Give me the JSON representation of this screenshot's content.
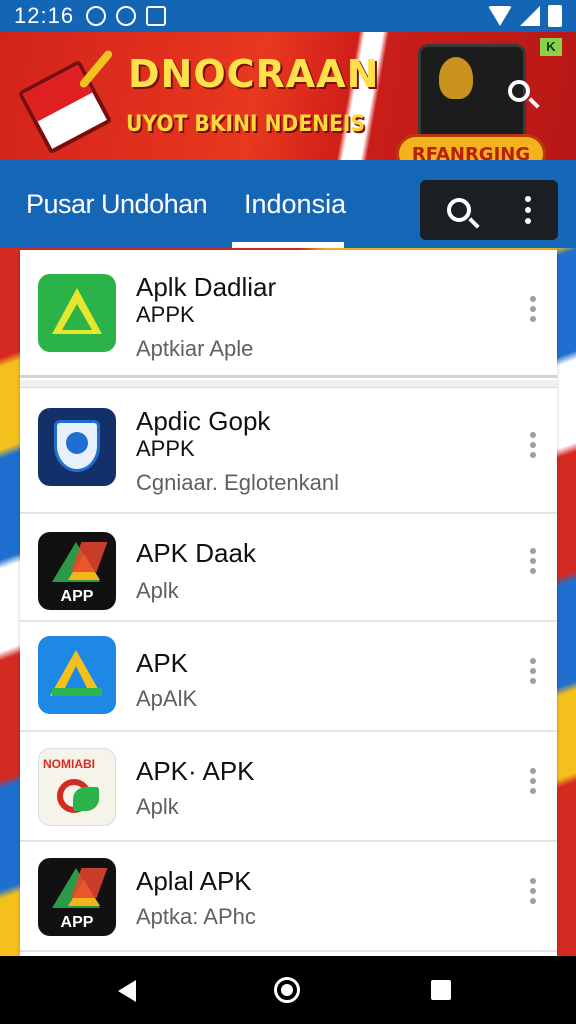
{
  "status_bar": {
    "time": "12:16",
    "icons": [
      "notification-icon",
      "app-icon",
      "image-icon",
      "wifi-icon",
      "signal-icon",
      "battery-icon"
    ]
  },
  "banner": {
    "title": "DNOCRAAN",
    "subtitle": "UYOT BKINI NDENEIS",
    "badge": "RFANRGING",
    "ad_mark": "K",
    "colors": {
      "primary": "#d52a22",
      "accent": "#ffe14a"
    }
  },
  "nav": {
    "tabs": [
      {
        "label": "Pusar Undohan"
      },
      {
        "label": "Indonsia",
        "active": true
      }
    ],
    "accent": "#1666b8"
  },
  "featured": {
    "title": "Aplk Dadliar",
    "subtitle": "APPK",
    "description": "Aptkiar Aple",
    "icon": "green-triangle-icon"
  },
  "apps": [
    {
      "title": "Apdic Gopk",
      "subtitle": "APPK",
      "description": "Cgniaar. Eglotenkanl",
      "icon": "shield-icon"
    },
    {
      "title": "APK Daak",
      "subtitle": "",
      "description": "Aplk",
      "icon": "app-drive-icon",
      "icon_label": "APP"
    },
    {
      "title": "APK",
      "subtitle": "",
      "description": "ApAlK",
      "icon": "blue-drive-icon"
    },
    {
      "title": "APK· APK",
      "subtitle": "",
      "description": "Aplk",
      "icon": "nomiabi-icon",
      "icon_label": "NOMIABI"
    },
    {
      "title": "Aplal APK",
      "subtitle": "",
      "description": "Aptka: APhc",
      "icon": "app-drive-icon-2",
      "icon_label": "APP"
    }
  ],
  "system_nav": {
    "buttons": [
      "back-button",
      "home-button",
      "recent-apps-button"
    ]
  }
}
